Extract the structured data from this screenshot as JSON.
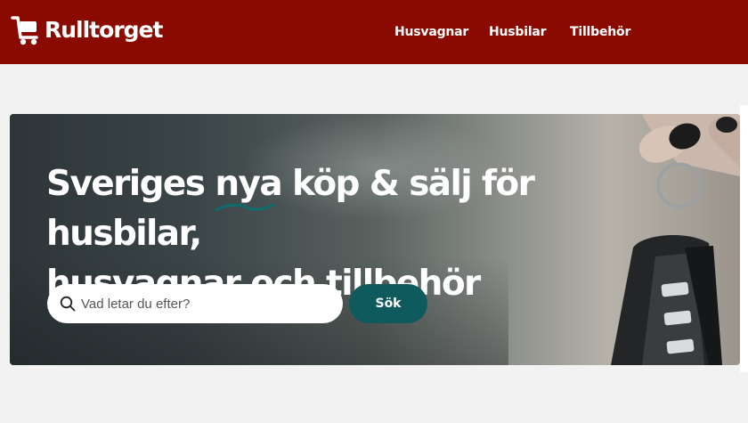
{
  "header": {
    "logo_text": "Rulltorget",
    "logo_icon": "shopping-cart-icon",
    "brand_color": "#8b0a00",
    "nav": [
      {
        "label": "Husvagnar"
      },
      {
        "label": "Husbilar"
      },
      {
        "label": "Tillbehör"
      }
    ]
  },
  "hero": {
    "title_before": "Sveriges ",
    "title_highlight": "nya",
    "title_after_line1": " köp & sälj för husbilar,",
    "title_line2": "husvagnar och tillbehör",
    "accent_color": "#0f5a5c"
  },
  "search": {
    "placeholder": "Vad letar du efter?",
    "value": "",
    "button_label": "Sök",
    "icon": "search-icon"
  }
}
